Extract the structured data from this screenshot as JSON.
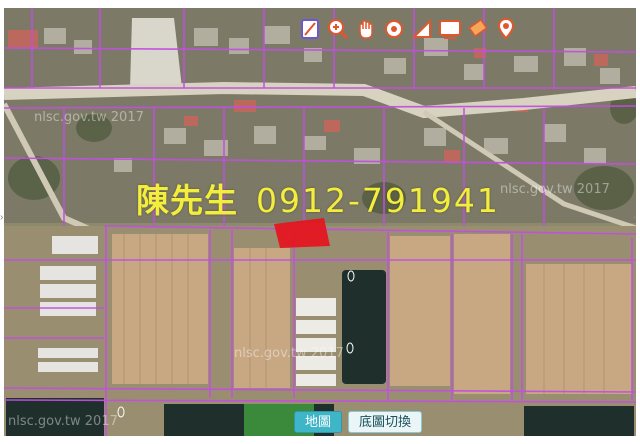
{
  "watermarks": {
    "top_left": "nlsc.gov.tw 2017",
    "top_right": "nlsc.gov.tw 2017",
    "center": "nlsc.gov.tw 2017",
    "bottom_left": "nlsc.gov.tw 2017"
  },
  "overlay": {
    "name": "陳先生",
    "phone": "0912-791941",
    "text_color": "#f3ee3e",
    "parcel_color": "#e8111c"
  },
  "toolbar": {
    "tools": [
      {
        "icon": "measure-ruler-icon"
      },
      {
        "icon": "zoom-in-icon"
      },
      {
        "icon": "pan-hand-icon"
      },
      {
        "icon": "locate-point-icon"
      },
      {
        "icon": "measure-area-icon"
      },
      {
        "icon": "info-panel-icon"
      },
      {
        "icon": "eraser-icon"
      },
      {
        "icon": "pin-settings-icon"
      }
    ]
  },
  "buttons": {
    "map": "地圖",
    "basemap_switch": "底圖切換"
  },
  "colors": {
    "boundary": "#c24fe0",
    "water": "#1f2f2c",
    "field": "#c8a883"
  }
}
